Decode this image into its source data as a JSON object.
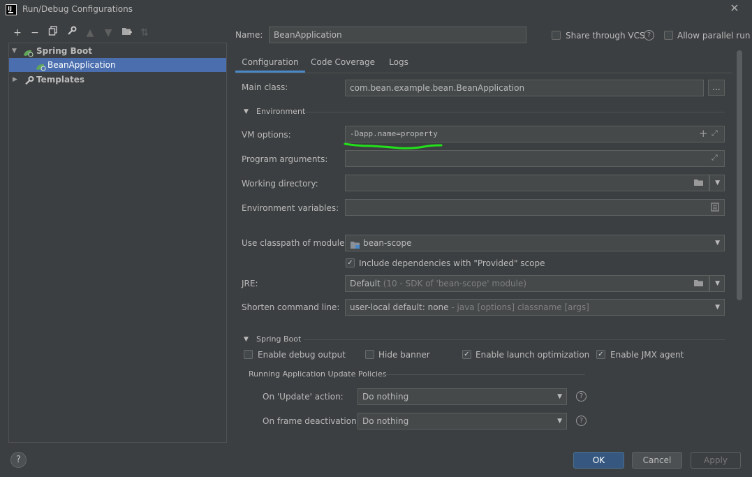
{
  "window": {
    "title": "Run/Debug Configurations",
    "app_icon": "IJ"
  },
  "tree": {
    "items": [
      {
        "label": "Spring Boot",
        "icon": "spring-boot-icon",
        "expanded": true
      },
      {
        "label": "BeanApplication",
        "icon": "spring-boot-app-icon",
        "selected": true
      },
      {
        "label": "Templates",
        "icon": "wrench-icon",
        "expanded": false
      }
    ]
  },
  "header": {
    "name_label": "Name:",
    "name_value": "BeanApplication",
    "share_vcs": "Share through VCS",
    "allow_parallel": "Allow parallel run"
  },
  "tabs": [
    "Configuration",
    "Code Coverage",
    "Logs"
  ],
  "form": {
    "main_class_label": "Main class:",
    "main_class_value": "com.bean.example.bean.BeanApplication",
    "browse_label": "...",
    "environment_label": "Environment",
    "vm_options_label": "VM options:",
    "vm_options_value": "-Dapp.name=property",
    "program_args_label": "Program arguments:",
    "working_dir_label": "Working directory:",
    "env_vars_label": "Environment variables:",
    "classpath_label": "Use classpath of module:",
    "classpath_value": "bean-scope",
    "include_deps_label": "Include dependencies with \"Provided\" scope",
    "jre_label": "JRE:",
    "jre_value": "Default",
    "jre_detail": "(10 - SDK of 'bean-scope' module)",
    "shorten_label": "Shorten command line:",
    "shorten_value": "user-local default: none",
    "shorten_detail": "- java [options] classname [args]"
  },
  "spring_boot": {
    "section_label": "Spring Boot",
    "debug_output": "Enable debug output",
    "hide_banner": "Hide banner",
    "launch_opt": "Enable launch optimization",
    "jmx_agent": "Enable JMX agent",
    "policies_label": "Running Application Update Policies",
    "update_action_label": "On 'Update' action:",
    "update_action_value": "Do nothing",
    "frame_deactivation_label": "On frame deactivation:",
    "frame_deactivation_value": "Do nothing"
  },
  "buttons": {
    "ok": "OK",
    "cancel": "Cancel",
    "apply": "Apply"
  },
  "colors": {
    "accent": "#4b6eaf",
    "ok_button": "#365880",
    "annotation": "#22e01a",
    "background": "#3c3f41"
  }
}
